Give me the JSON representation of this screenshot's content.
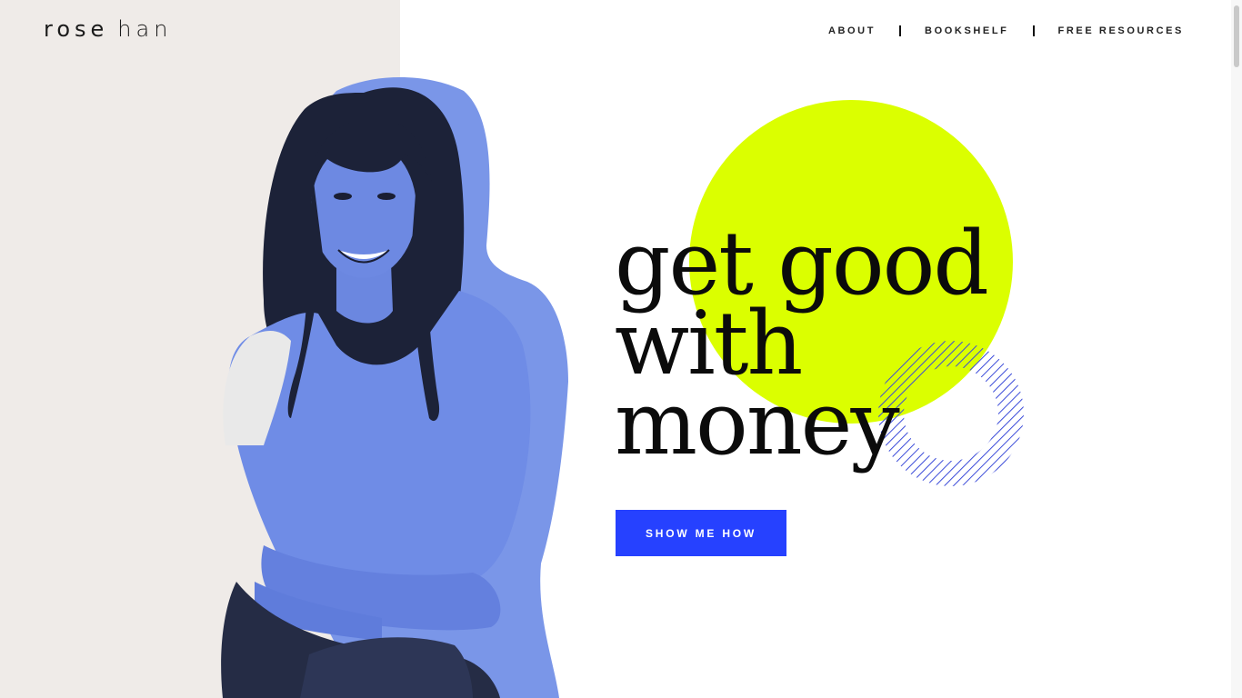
{
  "brand": {
    "first": "rose",
    "last": "han"
  },
  "nav": {
    "items": [
      {
        "label": "ABOUT"
      },
      {
        "label": "BOOKSHELF"
      },
      {
        "label": "FREE RESOURCES"
      }
    ]
  },
  "hero": {
    "headline_lines": [
      "get good",
      "with",
      "money"
    ],
    "cta_label": "SHOW ME HOW"
  },
  "colors": {
    "accent_blue": "#2641ff",
    "lime": "#dbff00",
    "silhouette_blue": "#7a96e8",
    "left_panel": "#efebe8"
  }
}
